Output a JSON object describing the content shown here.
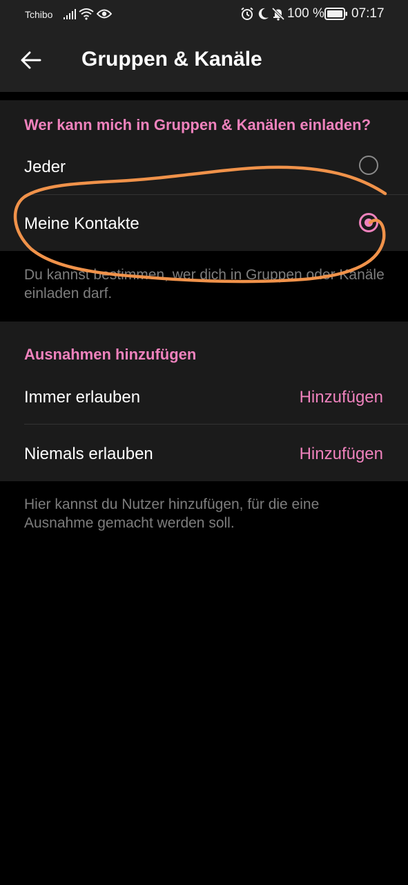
{
  "status_bar": {
    "carrier": "Tchibo",
    "battery": "100 %",
    "time": "07:17",
    "icons": [
      "signal-icon",
      "wifi-icon",
      "eye-icon",
      "alarm-icon",
      "moon-icon",
      "bell-off-icon",
      "battery-icon"
    ]
  },
  "header": {
    "title": "Gruppen & Kanäle",
    "back_icon": "arrow-left-icon"
  },
  "invite_section": {
    "heading": "Wer kann mich in Gruppen & Kanälen einladen?",
    "options": [
      {
        "label": "Jeder",
        "selected": false
      },
      {
        "label": "Meine Kontakte",
        "selected": true
      }
    ],
    "hint": "Du kannst bestimmen, wer dich in Gruppen oder Kanäle einladen darf."
  },
  "exceptions_section": {
    "heading": "Ausnahmen hinzufügen",
    "rows": [
      {
        "label": "Immer erlauben",
        "action": "Hinzufügen"
      },
      {
        "label": "Niemals erlauben",
        "action": "Hinzufügen"
      }
    ],
    "hint": "Hier kannst du Nutzer hinzufügen, für die eine Ausnahme gemacht werden soll."
  },
  "colors": {
    "accent": "#ef82bd",
    "surface": "#1b1b1b",
    "header": "#212121",
    "background": "#000000",
    "annotation": "#f0924a"
  }
}
